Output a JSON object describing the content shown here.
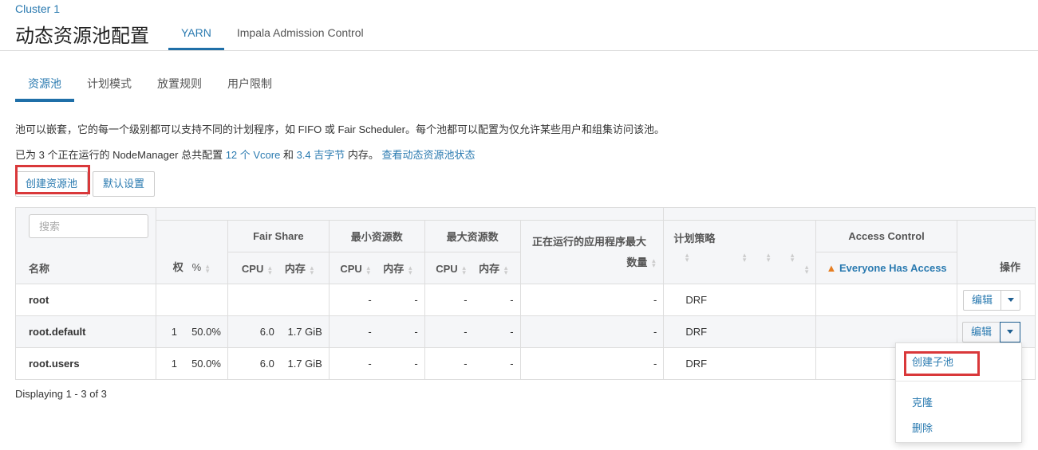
{
  "header": {
    "cluster": "Cluster 1",
    "title": "动态资源池配置",
    "tabs": [
      {
        "label": "YARN",
        "active": true
      },
      {
        "label": "Impala Admission Control",
        "active": false
      }
    ]
  },
  "subtabs": [
    {
      "label": "资源池",
      "active": true
    },
    {
      "label": "计划模式",
      "active": false
    },
    {
      "label": "放置规则",
      "active": false
    },
    {
      "label": "用户限制",
      "active": false
    }
  ],
  "description": "池可以嵌套，它的每一个级别都可以支持不同的计划程序，如 FIFO 或 Fair Scheduler。每个池都可以配置为仅允许某些用户和组集访问该池。",
  "summary": {
    "prefix": "已为 3 个正在运行的 NodeManager 总共配置 ",
    "vcore": "12 个 Vcore",
    "and": " 和 ",
    "memory": "3.4 吉字节",
    "suffix": " 内存。 ",
    "status_link": "查看动态资源池状态"
  },
  "buttons": {
    "create_pool": "创建资源池",
    "default_settings": "默认设置"
  },
  "table": {
    "search_placeholder": "搜索",
    "headers": {
      "name": "名称",
      "weight": "权",
      "percent": "%",
      "fair_share": "Fair Share",
      "min_resources": "最小资源数",
      "max_resources": "最大资源数",
      "cpu": "CPU",
      "memory": "内存",
      "max_running_apps_line1": "正在运行的应用程序最大",
      "max_running_apps_line2": "数量",
      "policy": "计划策略",
      "access_control": "Access Control",
      "access_value": "Everyone Has Access",
      "actions": "操作"
    },
    "rows": [
      {
        "name": "root",
        "weight": "",
        "percent": "",
        "fs_cpu": "",
        "fs_mem": "",
        "min_cpu": "-",
        "min_mem": "-",
        "max_cpu": "-",
        "max_mem": "-",
        "max_apps": "-",
        "policy": "DRF"
      },
      {
        "name": "root.default",
        "weight": "1",
        "percent": "50.0%",
        "fs_cpu": "6.0",
        "fs_mem": "1.7 GiB",
        "min_cpu": "-",
        "min_mem": "-",
        "max_cpu": "-",
        "max_mem": "-",
        "max_apps": "-",
        "policy": "DRF"
      },
      {
        "name": "root.users",
        "weight": "1",
        "percent": "50.0%",
        "fs_cpu": "6.0",
        "fs_mem": "1.7 GiB",
        "min_cpu": "-",
        "min_mem": "-",
        "max_cpu": "-",
        "max_mem": "-",
        "max_apps": "-",
        "policy": "DRF"
      }
    ],
    "edit_label": "编辑"
  },
  "footer": "Displaying 1 - 3 of 3",
  "dropdown": {
    "items": [
      "创建子池",
      "克隆",
      "删除"
    ]
  }
}
